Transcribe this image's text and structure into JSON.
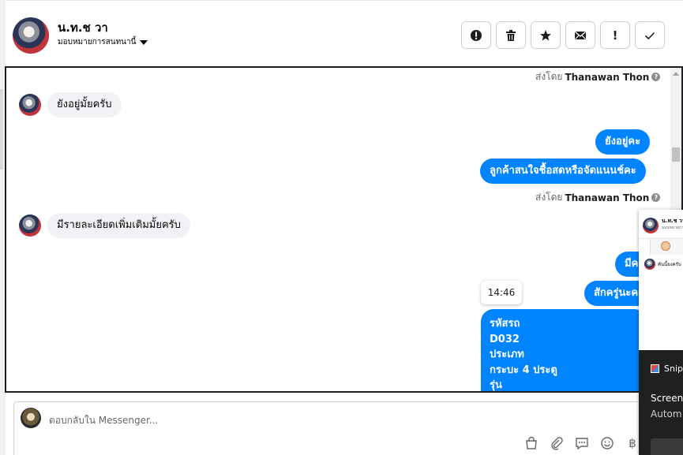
{
  "header": {
    "contact_name": "น.ท.ช วา",
    "assign_label": "มอบหมายการสนทนานี้",
    "actions": [
      {
        "name": "mark-spam",
        "label": ""
      },
      {
        "name": "delete",
        "label": ""
      },
      {
        "name": "star",
        "label": ""
      },
      {
        "name": "mark-unread",
        "label": ""
      },
      {
        "name": "follow-up",
        "label": "!"
      },
      {
        "name": "mark-done",
        "label": ""
      }
    ]
  },
  "conversation": {
    "sent_by_prefix": "ส่งโดย",
    "sent_by_name": "Thanawan Thon",
    "messages": {
      "in_1": "ยังอยู่มั้ยครับ",
      "out_1": "ยังอยู่คะ",
      "out_2": "ลูกค้าสนใจชื้อสดหรือจัดแนนช์คะ",
      "in_2": "มีรายละเอียดเพิ่มเติมมั้ยครับ",
      "out_3": "มีคะ",
      "out_4": "สักครู่นะคะ",
      "tooltip_time": "14:46",
      "details_lines": [
        "รหัสรถ",
        "D032",
        "ประเภท",
        "กระบะ 4 ประตู",
        "รุ่น"
      ]
    }
  },
  "popup": {
    "name": "น.ท.ช วา",
    "message": "คันนี้ยงครับ",
    "snip_title": "Snip",
    "line1": "Screen",
    "line2": "Autom"
  },
  "reply": {
    "placeholder": "ตอบกลับใน Messenger..."
  },
  "colors": {
    "bubble_out": "#0084ff",
    "bubble_in": "#f0f2f5"
  }
}
